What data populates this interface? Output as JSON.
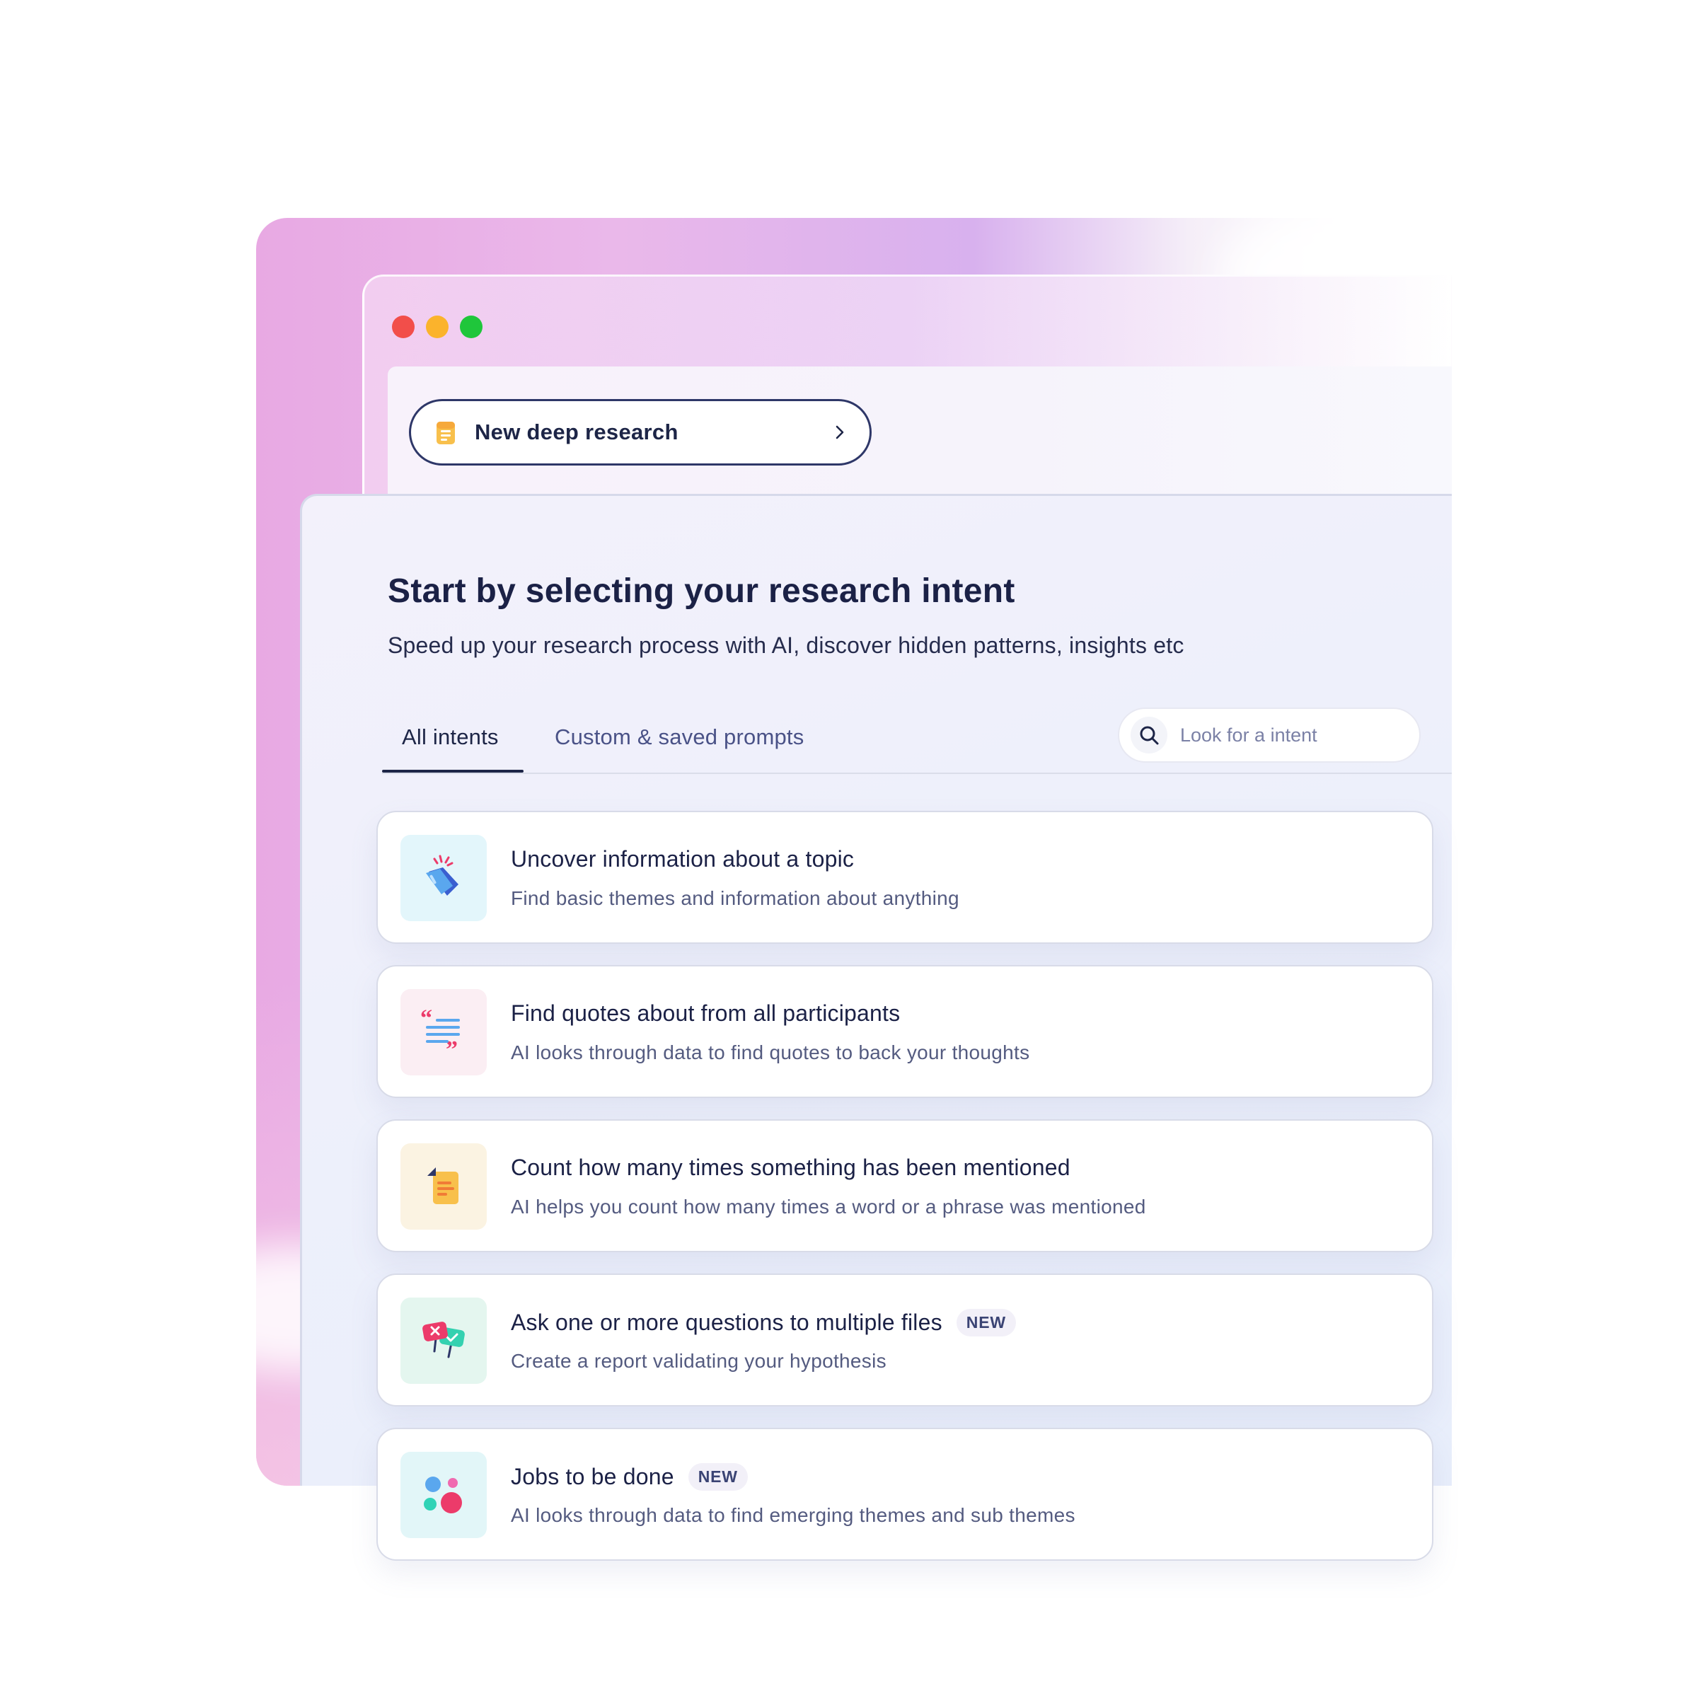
{
  "toolbar": {
    "deep_research_label": "New deep research"
  },
  "main": {
    "title": "Start by selecting your research intent",
    "subtitle": "Speed up your research process with AI, discover hidden patterns, insights etc",
    "tabs": [
      {
        "label": "All intents",
        "active": true
      },
      {
        "label": "Custom & saved prompts",
        "active": false
      }
    ],
    "search": {
      "placeholder": "Look for a intent",
      "value": ""
    }
  },
  "intents": [
    {
      "title": "Uncover information about a topic",
      "description": "Find basic themes and information about anything",
      "icon": "tag-sparkle-icon",
      "icon_bg": "#e3f6fb",
      "badge": ""
    },
    {
      "title": "Find quotes about from all participants",
      "description": "AI looks through data to find quotes to back your thoughts",
      "icon": "quote-icon",
      "icon_bg": "#fbeef3",
      "badge": ""
    },
    {
      "title": "Count how many times something has been mentioned",
      "description": "AI helps you count how many times a word or a phrase was mentioned",
      "icon": "document-icon",
      "icon_bg": "#fbf3e2",
      "badge": ""
    },
    {
      "title": "Ask one or more questions to multiple files",
      "description": "Create a report validating your hypothesis",
      "icon": "validate-signs-icon",
      "icon_bg": "#e4f6ef",
      "badge": "NEW"
    },
    {
      "title": "Jobs to be done",
      "description": "AI looks through data to find emerging themes and sub themes",
      "icon": "bubbles-icon",
      "icon_bg": "#e2f6f8",
      "badge": "NEW"
    }
  ],
  "colors": {
    "accent": "#1d2547",
    "window_red": "#f24e4a",
    "window_yellow": "#fbb32c",
    "window_green": "#1fc63b"
  }
}
